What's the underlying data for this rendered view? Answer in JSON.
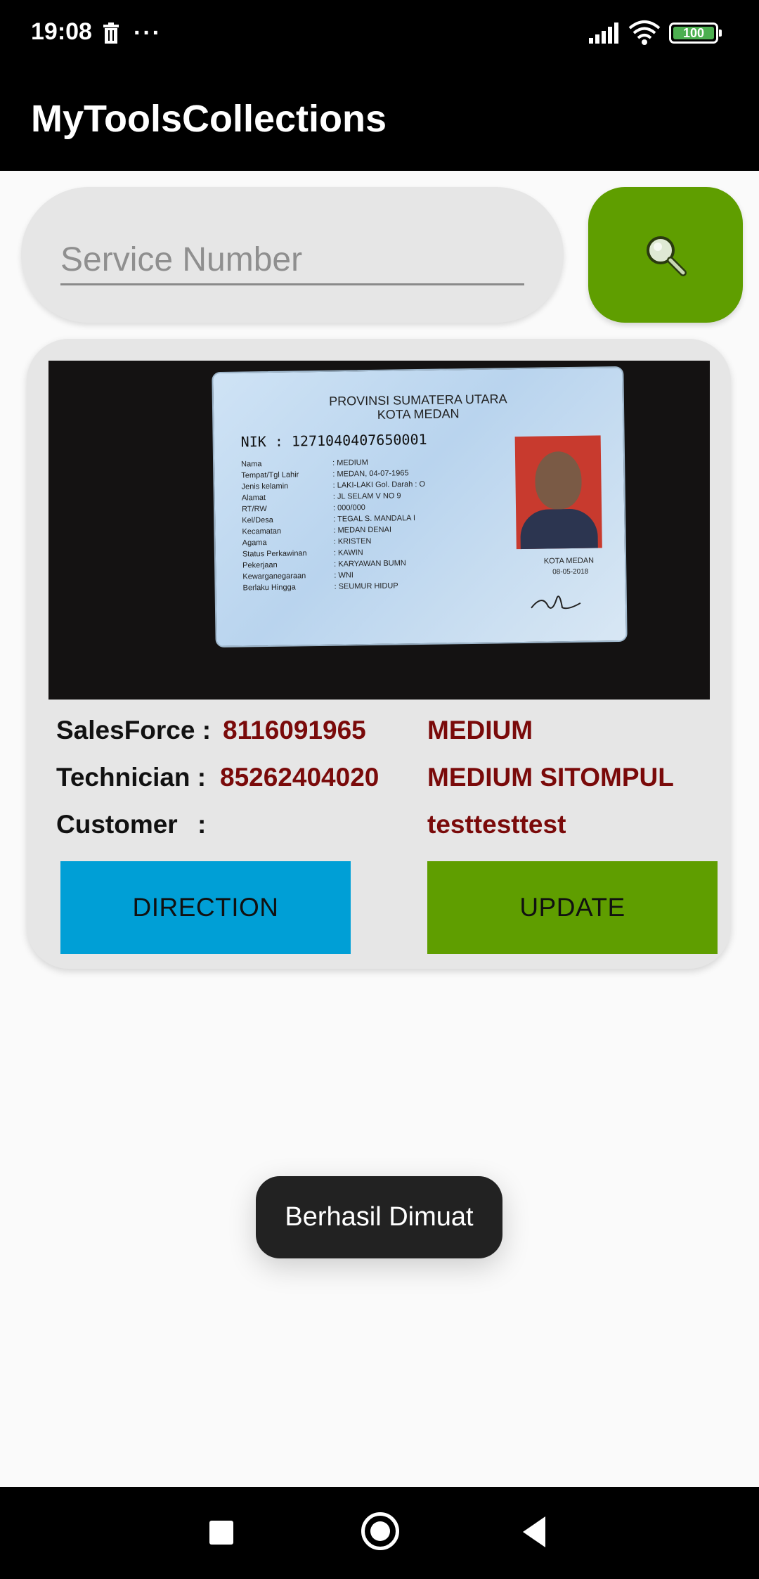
{
  "status_bar": {
    "time": "19:08",
    "overflow_indicator": "···",
    "battery": "100",
    "icons": [
      "trash-icon",
      "signal-icon",
      "wifi-icon",
      "battery-icon"
    ]
  },
  "app_bar": {
    "title": "MyToolsCollections"
  },
  "search": {
    "placeholder": "Service Number",
    "value": "",
    "button_icon": "search-icon"
  },
  "result_card": {
    "photo": {
      "province": "PROVINSI SUMATERA UTARA",
      "city": "KOTA MEDAN",
      "nik": "NIK    : 1271040407650001",
      "fields": [
        {
          "label": "Nama",
          "value": ": MEDIUM"
        },
        {
          "label": "Tempat/Tgl Lahir",
          "value": ": MEDAN, 04-07-1965"
        },
        {
          "label": "Jenis kelamin",
          "value": ": LAKI-LAKI   Gol. Darah : O"
        },
        {
          "label": "Alamat",
          "value": ": JL SELAM V NO 9"
        },
        {
          "label": "RT/RW",
          "value": ": 000/000"
        },
        {
          "label": "Kel/Desa",
          "value": ": TEGAL S. MANDALA I"
        },
        {
          "label": "Kecamatan",
          "value": ": MEDAN DENAI"
        },
        {
          "label": "Agama",
          "value": ": KRISTEN"
        },
        {
          "label": "Status Perkawinan",
          "value": ": KAWIN"
        },
        {
          "label": "Pekerjaan",
          "value": ": KARYAWAN BUMN"
        },
        {
          "label": "Kewarganegaraan",
          "value": ": WNI"
        },
        {
          "label": "Berlaku Hingga",
          "value": ": SEUMUR HIDUP"
        }
      ],
      "sign_city": "KOTA MEDAN",
      "sign_date": "08-05-2018"
    },
    "salesforce": {
      "label": "SalesForce :",
      "id": "8116091965",
      "name": "MEDIUM"
    },
    "technician": {
      "label": "Technician :",
      "id": "85262404020",
      "name": "MEDIUM SITOMPUL"
    },
    "customer": {
      "label": "Customer",
      "colon": ":",
      "name": "testtesttest"
    },
    "direction_button": {
      "label": "DIRECTION",
      "color": "#009fd6"
    },
    "update_button": {
      "label": "UPDATE",
      "color": "#5f9e00"
    }
  },
  "toast": {
    "message": "Berhasil Dimuat"
  },
  "nav_bar": {
    "icons": [
      "recents-icon",
      "home-icon",
      "back-icon"
    ]
  },
  "colors": {
    "accent_green": "#5f9e00",
    "accent_blue": "#009fd6",
    "value_red": "#7a0a0a"
  }
}
